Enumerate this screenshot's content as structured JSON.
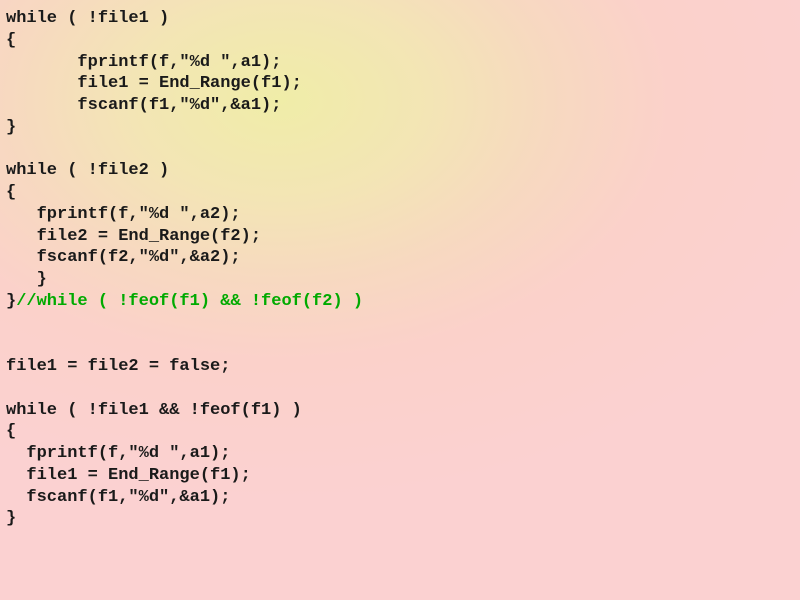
{
  "code": {
    "lines": [
      {
        "text": "while ( !file1 )",
        "comment": ""
      },
      {
        "text": "{",
        "comment": ""
      },
      {
        "text": "       fprintf(f,\"%d \",a1);",
        "comment": ""
      },
      {
        "text": "       file1 = End_Range(f1);",
        "comment": ""
      },
      {
        "text": "       fscanf(f1,\"%d\",&a1);",
        "comment": ""
      },
      {
        "text": "}",
        "comment": ""
      },
      {
        "text": "",
        "comment": ""
      },
      {
        "text": "while ( !file2 )",
        "comment": ""
      },
      {
        "text": "{",
        "comment": ""
      },
      {
        "text": "   fprintf(f,\"%d \",a2);",
        "comment": ""
      },
      {
        "text": "   file2 = End_Range(f2);",
        "comment": ""
      },
      {
        "text": "   fscanf(f2,\"%d\",&a2);",
        "comment": ""
      },
      {
        "text": "   }",
        "comment": ""
      },
      {
        "text": "}",
        "comment": "//while ( !feof(f1) && !feof(f2) )"
      },
      {
        "text": "",
        "comment": ""
      },
      {
        "text": "",
        "comment": ""
      },
      {
        "text": "file1 = file2 = false;",
        "comment": ""
      },
      {
        "text": "",
        "comment": ""
      },
      {
        "text": "while ( !file1 && !feof(f1) )",
        "comment": ""
      },
      {
        "text": "{",
        "comment": ""
      },
      {
        "text": "  fprintf(f,\"%d \",a1);",
        "comment": ""
      },
      {
        "text": "  file1 = End_Range(f1);",
        "comment": ""
      },
      {
        "text": "  fscanf(f1,\"%d\",&a1);",
        "comment": ""
      },
      {
        "text": "}",
        "comment": ""
      }
    ]
  }
}
